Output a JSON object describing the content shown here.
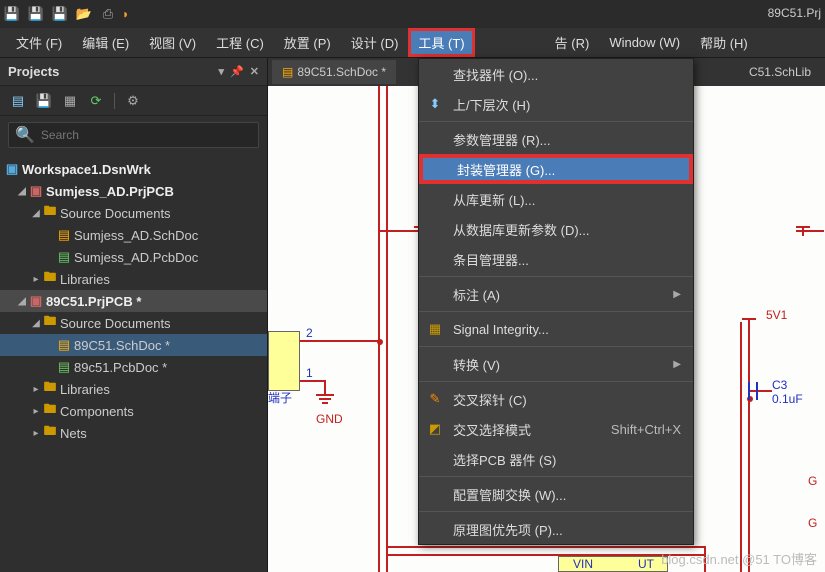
{
  "app": {
    "title": "89C51.Prj"
  },
  "menubar": {
    "file": "文件 (F)",
    "edit": "编辑 (E)",
    "view": "视图 (V)",
    "project": "工程 (C)",
    "place": "放置 (P)",
    "design": "设计 (D)",
    "tools": "工具 (T)",
    "report": "告 (R)",
    "window": "Window (W)",
    "help": "帮助 (H)"
  },
  "projects": {
    "title": "Projects",
    "search_placeholder": "Search",
    "workspace": "Workspace1.DsnWrk",
    "tree": {
      "p1": {
        "name": "Sumjess_AD.PrjPCB",
        "src": "Source Documents",
        "d1": "Sumjess_AD.SchDoc",
        "d2": "Sumjess_AD.PcbDoc",
        "lib": "Libraries"
      },
      "p2": {
        "name": "89C51.PrjPCB *",
        "src": "Source Documents",
        "d1": "89C51.SchDoc *",
        "d2": "89c51.PcbDoc *",
        "lib": "Libraries",
        "comp": "Components",
        "nets": "Nets"
      }
    }
  },
  "tabs": {
    "t1": "89C51.SchDoc *",
    "t2": "C51.SchLib"
  },
  "tools_menu": {
    "find": "查找器件 (O)...",
    "hier": "上/下层次 (H)",
    "param": "参数管理器 (R)...",
    "footprint": "封装管理器 (G)...",
    "updlib": "从库更新 (L)...",
    "upddb": "从数据库更新参数 (D)...",
    "itemmgr": "条目管理器...",
    "annotate": "标注 (A)",
    "sigint": "Signal Integrity...",
    "convert": "转换 (V)",
    "xprobe": "交叉探针 (C)",
    "xsel": "交叉选择模式",
    "xsel_sc": "Shift+Ctrl+X",
    "selpcb": "选择PCB 器件 (S)",
    "pinswap": "配置管脚交换 (W)...",
    "schpref": "原理图优先项 (P)..."
  },
  "schematic": {
    "gnd": "GND",
    "pin2": "2",
    "pin1": "1",
    "term": "端子",
    "c3": "C3",
    "c3v": "0.1uF",
    "g": "G",
    "vin": "VIN",
    "out": "UT",
    "pvdd": "5V1"
  },
  "watermark": "blog.csdn.net @51 TO博客"
}
